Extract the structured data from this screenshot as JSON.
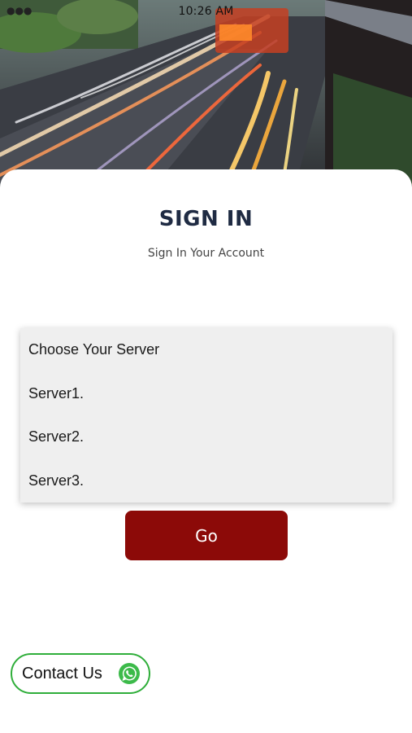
{
  "status_bar": {
    "time": "10:26 AM"
  },
  "header": {
    "title": "SIGN IN",
    "subtitle": "Sign In Your Account"
  },
  "server_list": {
    "items": [
      {
        "label": "Choose Your Server"
      },
      {
        "label": "Server1."
      },
      {
        "label": "Server2."
      },
      {
        "label": "Server3."
      }
    ]
  },
  "actions": {
    "go_label": "Go"
  },
  "contact": {
    "label": "Contact Us",
    "icon": "whatsapp-icon"
  },
  "colors": {
    "title": "#1f2b43",
    "primary_button": "#8c0a08",
    "contact_border": "#2fae3a",
    "whatsapp_green": "#3cba4a",
    "list_background": "#efefef"
  }
}
